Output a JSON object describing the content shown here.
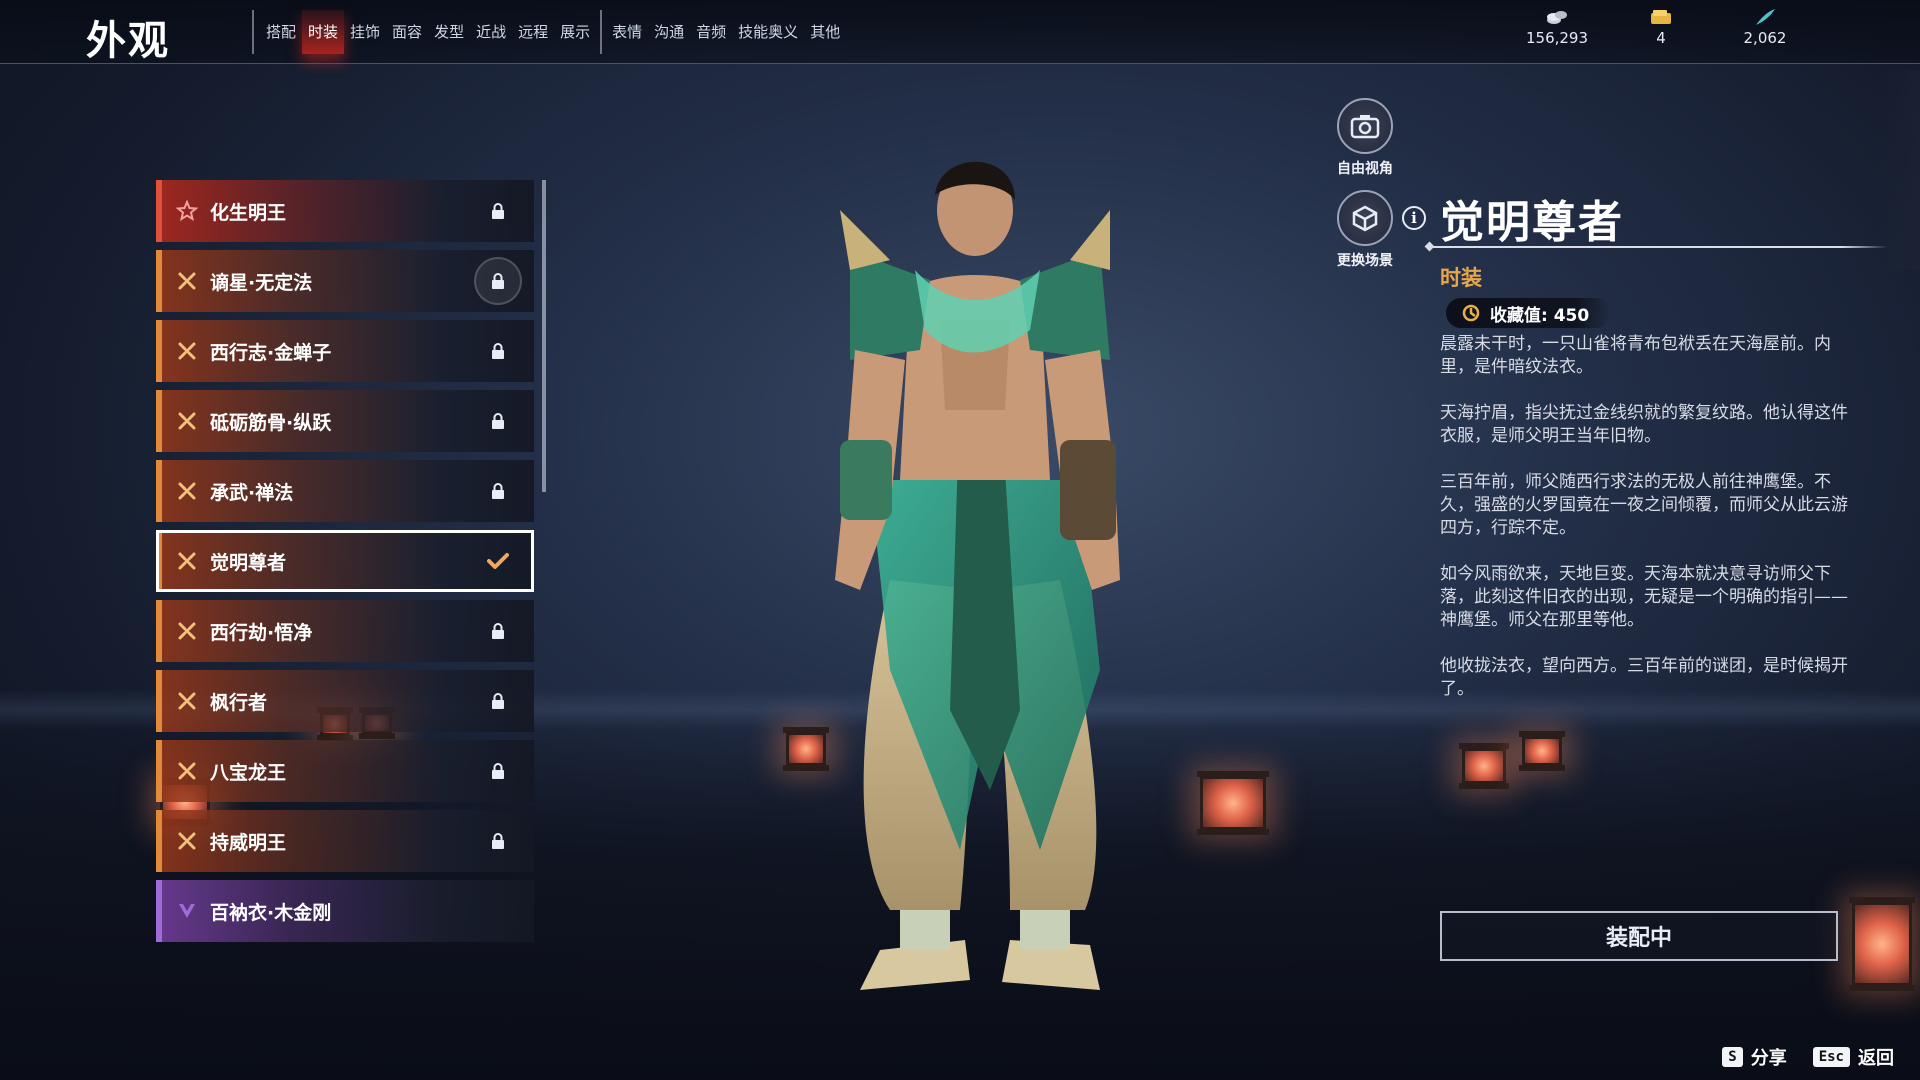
{
  "page_title": "外观",
  "tabs": [
    {
      "label": "搭配",
      "active": false
    },
    {
      "label": "时装",
      "active": true
    },
    {
      "label": "挂饰",
      "active": false
    },
    {
      "label": "面容",
      "active": false
    },
    {
      "label": "发型",
      "active": false
    },
    {
      "label": "近战",
      "active": false
    },
    {
      "label": "远程",
      "active": false
    },
    {
      "label": "展示",
      "active": false
    },
    {
      "label": "表情",
      "active": false
    },
    {
      "label": "沟通",
      "active": false
    },
    {
      "label": "音频",
      "active": false
    },
    {
      "label": "技能奥义",
      "active": false
    },
    {
      "label": "其他",
      "active": false
    }
  ],
  "currencies": [
    {
      "icon": "coin-stack-icon",
      "value": "156,293"
    },
    {
      "icon": "ticket-icon",
      "value": "4"
    },
    {
      "icon": "feather-icon",
      "value": "2,062"
    }
  ],
  "outfits": [
    {
      "name": "化生明王",
      "rarity": "red",
      "state": "locked"
    },
    {
      "name": "谪星·无定法",
      "rarity": "orange",
      "state": "locked-ring"
    },
    {
      "name": "西行志·金蝉子",
      "rarity": "orange",
      "state": "locked"
    },
    {
      "name": "砥砺筋骨·纵跃",
      "rarity": "orange",
      "state": "locked"
    },
    {
      "name": "承武·禅法",
      "rarity": "orange",
      "state": "locked"
    },
    {
      "name": "觉明尊者",
      "rarity": "orange",
      "state": "equipped"
    },
    {
      "name": "西行劫·悟净",
      "rarity": "orange",
      "state": "locked"
    },
    {
      "name": "枫行者",
      "rarity": "orange",
      "state": "locked"
    },
    {
      "name": "八宝龙王",
      "rarity": "orange",
      "state": "locked"
    },
    {
      "name": "持威明王",
      "rarity": "orange",
      "state": "locked"
    },
    {
      "name": "百衲衣·木金刚",
      "rarity": "purple",
      "state": "none"
    }
  ],
  "side_buttons": {
    "free_view": "自由视角",
    "change_scene": "更换场景"
  },
  "detail": {
    "title": "觉明尊者",
    "category": "时装",
    "collect_label": "收藏值: 450",
    "paragraphs": [
      "晨露未干时，一只山雀将青布包袱丢在天海屋前。内里，是件暗纹法衣。",
      "天海拧眉，指尖抚过金线织就的繁复纹路。他认得这件衣服，是师父明王当年旧物。",
      "三百年前，师父随西行求法的无极人前往神鹰堡。不久，强盛的火罗国竟在一夜之间倾覆，而师父从此云游四方，行踪不定。",
      "如今风雨欲来，天地巨变。天海本就决意寻访师父下落，此刻这件旧衣的出现，无疑是一个明确的指引——神鹰堡。师父在那里等他。",
      "他收拢法衣，望向西方。三百年前的谜团，是时候揭开了。"
    ],
    "equip_button": "装配中"
  },
  "hints": [
    {
      "key": "S",
      "label": "分享"
    },
    {
      "key": "Esc",
      "label": "返回"
    }
  ],
  "colors": {
    "accent_red": "#e0503a",
    "rarity_orange": "#e08a3a",
    "rarity_purple": "#a06ad8",
    "category_gold": "#e8a64a"
  }
}
